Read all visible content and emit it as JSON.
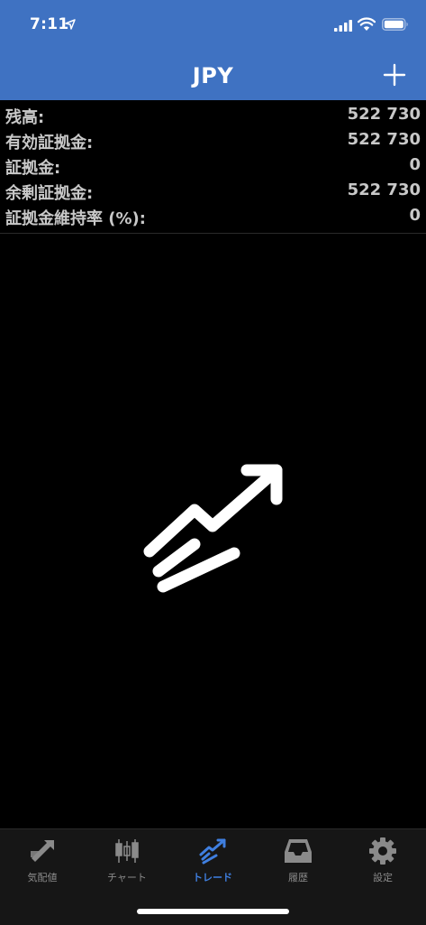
{
  "status_bar": {
    "time": "7:11"
  },
  "header": {
    "title": "JPY",
    "add_icon": "plus-icon"
  },
  "account_summary": [
    {
      "label": "残高:",
      "value": "522 730"
    },
    {
      "label": "有効証拠金:",
      "value": "522 730"
    },
    {
      "label": "証拠金:",
      "value": "0"
    },
    {
      "label": "余剰証拠金:",
      "value": "522 730"
    },
    {
      "label": "証拠金維持率 (%):",
      "value": "0"
    }
  ],
  "empty_state": {
    "icon": "trade-trend-icon"
  },
  "tab_bar": {
    "tabs": [
      {
        "label": "気配値",
        "icon": "quotes-icon",
        "active": false
      },
      {
        "label": "チャート",
        "icon": "candlestick-chart-icon",
        "active": false
      },
      {
        "label": "トレード",
        "icon": "trade-icon",
        "active": true
      },
      {
        "label": "履歴",
        "icon": "history-inbox-icon",
        "active": false
      },
      {
        "label": "設定",
        "icon": "settings-gear-icon",
        "active": false
      }
    ]
  },
  "colors": {
    "header_background": "#3f72c2",
    "active_tab": "#3f7fe0",
    "inactive_tab": "#8a8a8a",
    "background": "#000000"
  }
}
